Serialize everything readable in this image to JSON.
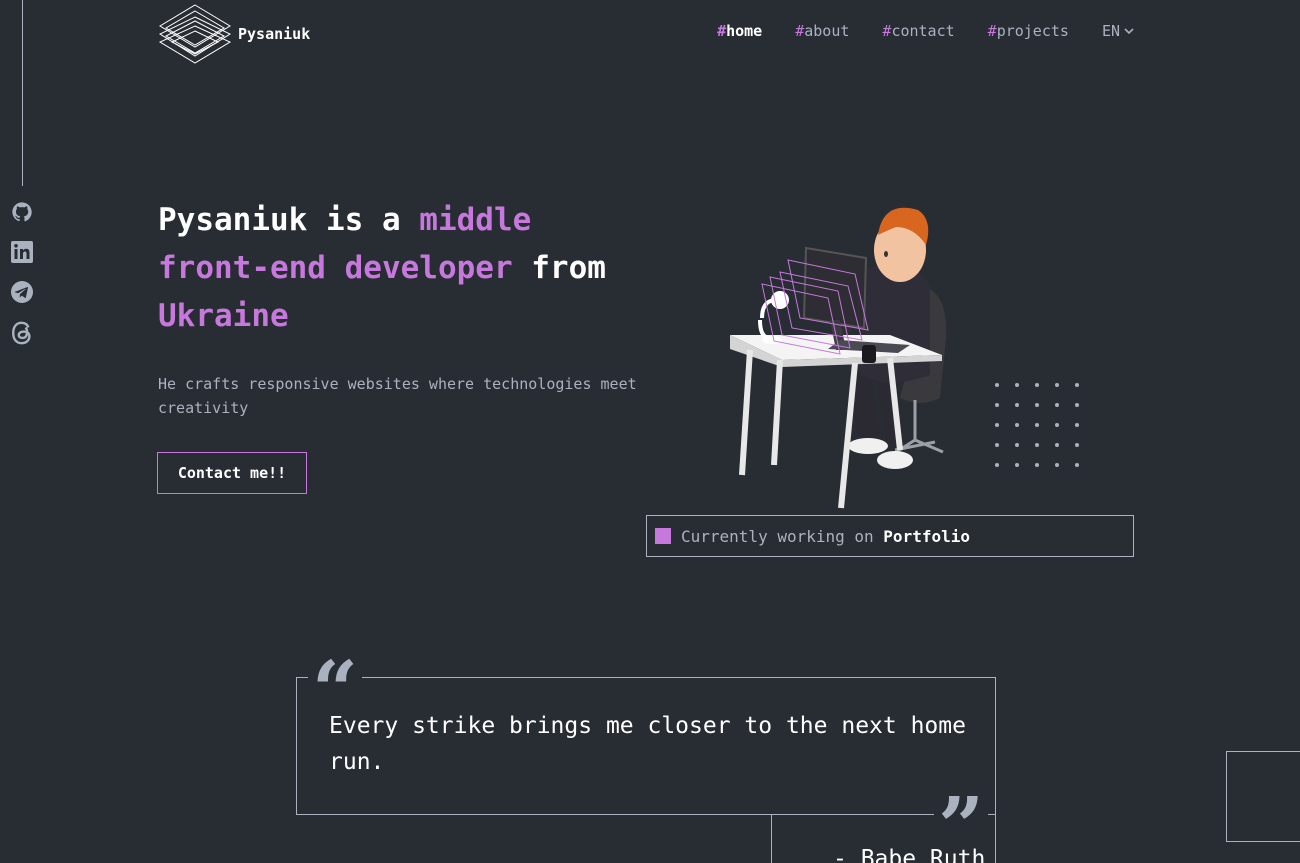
{
  "brand": {
    "name": "Pysaniuk"
  },
  "nav": {
    "items": [
      {
        "hash": "#",
        "label": "home",
        "active": true
      },
      {
        "hash": "#",
        "label": "about",
        "active": false
      },
      {
        "hash": "#",
        "label": "contact",
        "active": false
      },
      {
        "hash": "#",
        "label": "projects",
        "active": false
      }
    ],
    "language": "EN"
  },
  "social": [
    "github-icon",
    "linkedin-icon",
    "telegram-icon",
    "threads-icon"
  ],
  "hero": {
    "title_1": "Pysaniuk is a ",
    "title_2": "middle front-end developer",
    "title_3": " from ",
    "title_4": "Ukraine",
    "subtitle": "He crafts responsive websites where technologies meet creativity",
    "cta": "Contact me!!"
  },
  "status": {
    "prefix": "Currently working on ",
    "project": "Portfolio"
  },
  "quote": {
    "text": "Every strike brings me closer to the next home run.",
    "author": "- Babe Ruth",
    "open_mark": "“",
    "close_mark": "”"
  },
  "colors": {
    "background": "#282c33",
    "accent": "#c778dd",
    "muted": "#abb2bf",
    "text": "#ffffff"
  }
}
